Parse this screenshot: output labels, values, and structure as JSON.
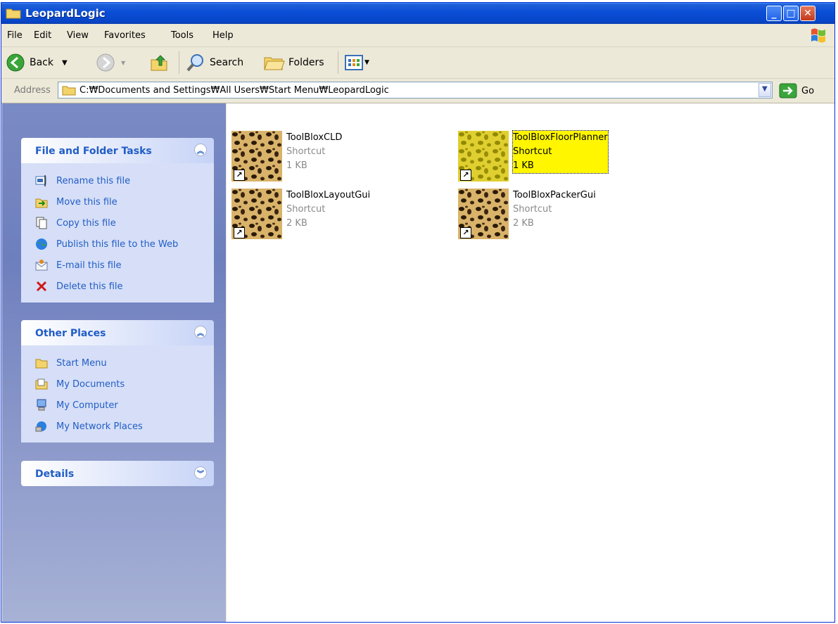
{
  "window": {
    "title": "LeopardLogic"
  },
  "menubar": {
    "items": [
      "File",
      "Edit",
      "View",
      "Favorites",
      "Tools",
      "Help"
    ]
  },
  "toolbar": {
    "back_label": "Back",
    "search_label": "Search",
    "folders_label": "Folders"
  },
  "address": {
    "label": "Address",
    "value": "C:₩Documents and Settings₩All Users₩Start Menu₩LeopardLogic",
    "go_label": "Go"
  },
  "tasks_panel": {
    "title": "File and Folder Tasks",
    "items": [
      {
        "label": "Rename this file",
        "icon": "rename-icon"
      },
      {
        "label": "Move this file",
        "icon": "move-icon"
      },
      {
        "label": "Copy this file",
        "icon": "copy-icon"
      },
      {
        "label": "Publish this file to the Web",
        "icon": "publish-web-icon"
      },
      {
        "label": "E-mail this file",
        "icon": "email-icon"
      },
      {
        "label": "Delete this file",
        "icon": "delete-icon"
      }
    ]
  },
  "other_places": {
    "title": "Other Places",
    "items": [
      {
        "label": "Start Menu",
        "icon": "folder-icon"
      },
      {
        "label": "My Documents",
        "icon": "my-documents-icon"
      },
      {
        "label": "My Computer",
        "icon": "my-computer-icon"
      },
      {
        "label": "My Network Places",
        "icon": "network-places-icon"
      }
    ]
  },
  "details_panel": {
    "title": "Details"
  },
  "files": [
    {
      "name": "ToolBloxCLD",
      "type": "Shortcut",
      "size": "1 KB",
      "selected": false
    },
    {
      "name": "ToolBloxFloorPlanner",
      "type": "Shortcut",
      "size": "1 KB",
      "selected": true
    },
    {
      "name": "ToolBloxLayoutGui",
      "type": "Shortcut",
      "size": "2 KB",
      "selected": false
    },
    {
      "name": "ToolBloxPackerGui",
      "type": "Shortcut",
      "size": "2 KB",
      "selected": false
    }
  ],
  "colors": {
    "titlebar": "#0a4ed6",
    "selection": "#fff600",
    "task_link": "#215dc6"
  }
}
